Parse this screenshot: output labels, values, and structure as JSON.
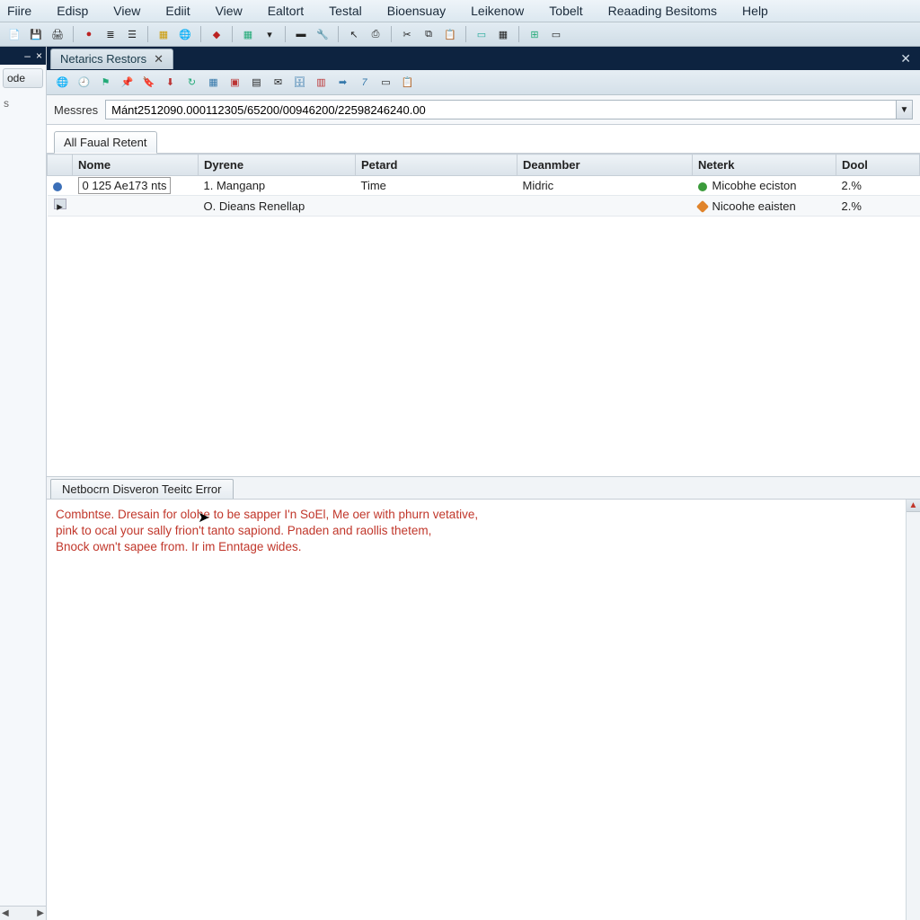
{
  "menu": {
    "items": [
      "Fiire",
      "Edisp",
      "View",
      "Ediit",
      "View",
      "Ealtort",
      "Testal",
      "Bioensuay",
      "Leikenow",
      "Tobelt",
      "Reaading Besitoms",
      "Help"
    ]
  },
  "toolbar_main": {
    "icons": [
      "doc-icon",
      "save-icon",
      "print-icon",
      "record-icon",
      "list-icon",
      "justify-icon",
      "table-icon",
      "globe-icon",
      "pin-icon",
      "grid-icon",
      "dropdown-icon",
      "minus-icon",
      "wrench-icon",
      "pointer-icon",
      "stamp-icon",
      "trim-icon",
      "copy-icon",
      "paste-icon",
      "screen-icon",
      "layout-icon",
      "tree-icon",
      "panel-icon"
    ]
  },
  "left_panel": {
    "tab_label": "ode",
    "body_char": "s",
    "top_controls": [
      "–",
      "×"
    ]
  },
  "doc_tab": {
    "title": "Netarics Restors"
  },
  "doc_toolbar": {
    "icons": [
      "globe-icon",
      "clock-icon",
      "flag-icon",
      "pin-icon",
      "bookmark-icon",
      "download-icon",
      "refresh-icon",
      "grid-icon",
      "app-icon",
      "form-icon",
      "mail-icon",
      "db-icon",
      "layers-icon",
      "forward-icon",
      "seven-icon",
      "window-icon",
      "clipboard-icon"
    ]
  },
  "messages": {
    "label": "Messres",
    "value": "Mánt2512090.000112305/65200/00946200/22598246240.00"
  },
  "filter_tab": {
    "label": "All Faual Retent"
  },
  "grid": {
    "columns": [
      "",
      "Nome",
      "Dyrene",
      "Petard",
      "Deanmber",
      "Neterk",
      "Dool"
    ],
    "rows": [
      {
        "gutter": "blue",
        "id": "0 125  Ae173 nts",
        "dyrene": "1.  Manganp",
        "petard": "Time",
        "deanmber": "Midric",
        "neterk_dot": "green",
        "neterk": "Micobhe eciston",
        "dool": "2.%"
      },
      {
        "gutter": "play",
        "id": "",
        "dyrene": "O. Dieans Renellap",
        "petard": "",
        "deanmber": "",
        "neterk_dot": "orange",
        "neterk": "Nicoohe eaisten",
        "dool": "2.%"
      }
    ]
  },
  "bottom_tab": {
    "label": "Netbocrn Disveron Teeitc Error"
  },
  "error": {
    "lines": [
      "Combntse. Dresain for olohe to be sapper I'n SoEl, Me oer with phurn vetative,",
      "pink to ocal your sally frion't tanto sapiond. Pnaden and raollis thetem,",
      "Bnock own't sapee from. Ir im Enntage wides."
    ]
  }
}
